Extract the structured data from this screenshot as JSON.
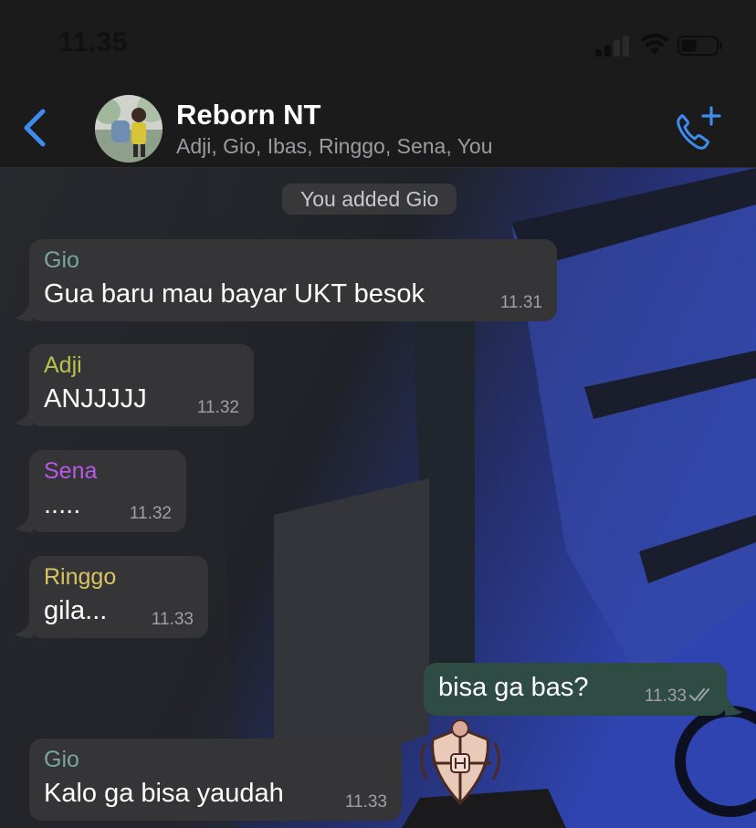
{
  "status_bar": {
    "time": "11.35"
  },
  "header": {
    "title": "Reborn NT",
    "members": "Adji, Gio, Ibas, Ringgo, Sena, You"
  },
  "system_message": "You added Gio",
  "messages": [
    {
      "sender": "Gio",
      "sender_color": "#77a79c",
      "text": "Gua baru mau bayar UKT besok",
      "time": "11.31",
      "direction": "incoming"
    },
    {
      "sender": "Adji",
      "sender_color": "#b6c24e",
      "text": "ANJJJJJ",
      "time": "11.32",
      "direction": "incoming"
    },
    {
      "sender": "Sena",
      "sender_color": "#b45ae6",
      "text": ".....",
      "time": "11.32",
      "direction": "incoming"
    },
    {
      "sender": "Ringgo",
      "sender_color": "#d8c462",
      "text": "gila...",
      "time": "11.33",
      "direction": "incoming"
    },
    {
      "sender": "",
      "text": "bisa ga bas?",
      "time": "11.33",
      "direction": "outgoing",
      "status": "read"
    },
    {
      "sender": "Gio",
      "sender_color": "#77a79c",
      "text": "Kalo ga bisa yaudah",
      "time": "11.33",
      "direction": "incoming"
    }
  ],
  "colors": {
    "accent": "#3f8cf0",
    "incoming_bubble": "#353537",
    "outgoing_bubble": "#2f4c44"
  }
}
